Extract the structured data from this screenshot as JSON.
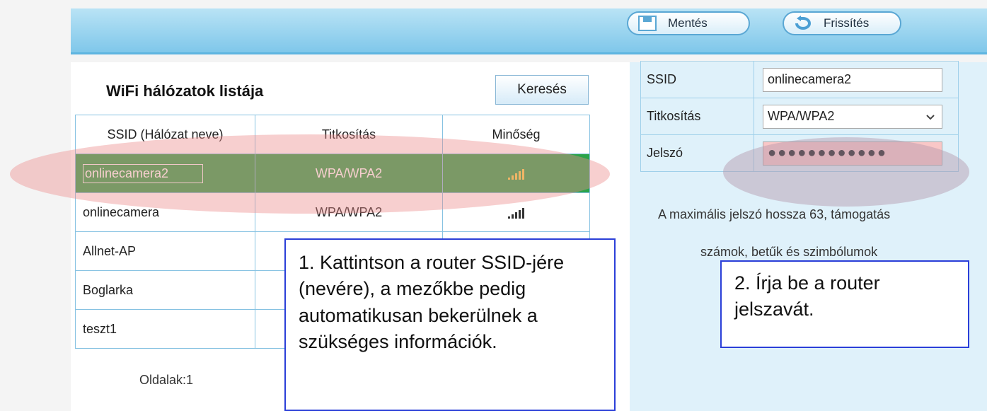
{
  "toolbar": {
    "save_label": "Mentés",
    "refresh_label": "Frissítés",
    "save_icon": "floppy-disk-icon",
    "refresh_icon": "refresh-arrow-icon"
  },
  "wifi_list": {
    "title": "WiFi hálózatok listája",
    "search_label": "Keresés",
    "columns": [
      "SSID (Hálózat neve)",
      "Titkosítás",
      "Minőség"
    ],
    "rows": [
      {
        "ssid": "onlinecamera2",
        "encryption": "WPA/WPA2",
        "signal": "signal-bars-icon",
        "selected": true
      },
      {
        "ssid": "onlinecamera",
        "encryption": "WPA/WPA2",
        "signal": "signal-bars-icon",
        "selected": false
      },
      {
        "ssid": "Allnet-AP",
        "encryption": "",
        "signal": "",
        "selected": false
      },
      {
        "ssid": "Boglarka",
        "encryption": "",
        "signal": "",
        "selected": false
      },
      {
        "ssid": "teszt1",
        "encryption": "",
        "signal": "",
        "selected": false
      }
    ],
    "pages_label": "Oldalak:1"
  },
  "form": {
    "ssid_label": "SSID",
    "ssid_value": "onlinecamera2",
    "encryption_label": "Titkosítás",
    "encryption_value": "WPA/WPA2",
    "password_label": "Jelszó",
    "password_value": "●●●●●●●●●●●●",
    "hint_line1": "A maximális jelszó hossza 63, támogatás",
    "hint_line2": "számok, betűk és szimbólumok"
  },
  "callouts": {
    "step1": "1. Kattintson a router SSID-jére (nevére), a mezőkbe pedig automatikusan bekerülnek a szükséges információk.",
    "step2": "2. Írja be a router jelszavát."
  },
  "colors": {
    "selected_row": "#2aa34a",
    "toolbar_blue": "#7fc7ea",
    "highlight_red": "#eb8c8c",
    "callout_border": "#2b3fd8"
  }
}
